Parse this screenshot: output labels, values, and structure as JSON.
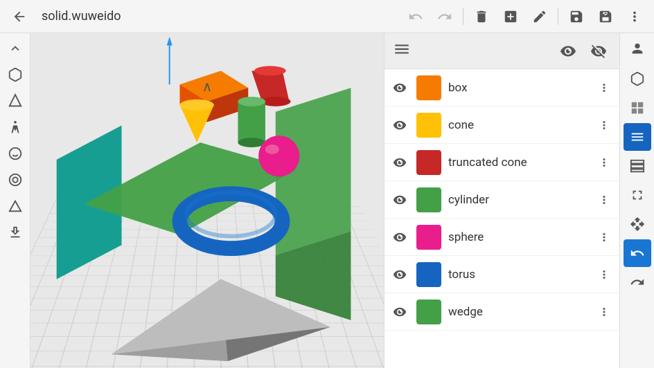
{
  "header": {
    "back_icon": "←",
    "title": "solid.wuweido",
    "undo_icon": "←",
    "redo_icon": "→",
    "delete_icon": "🗑",
    "add_icon": "⊞",
    "edit_icon": "✎",
    "save_icon": "💾",
    "save_as_icon": "💾+",
    "more_icon": "⋮"
  },
  "left_sidebar": {
    "items": [
      {
        "name": "move-up-btn",
        "icon": "∧"
      },
      {
        "name": "box-btn",
        "icon": "□"
      },
      {
        "name": "cone-btn",
        "icon": "△"
      },
      {
        "name": "figure-btn",
        "icon": "🧍"
      },
      {
        "name": "head-btn",
        "icon": "😀"
      },
      {
        "name": "ring-btn",
        "icon": "⊙"
      },
      {
        "name": "triangle-btn",
        "icon": "△"
      },
      {
        "name": "download-btn",
        "icon": "⬇"
      }
    ]
  },
  "panel": {
    "header_icon": "☰",
    "eye_open_icon": "👁",
    "eye_closed_icon": "—",
    "shapes": [
      {
        "name": "box",
        "color": "#f57c00",
        "visible": true
      },
      {
        "name": "cone",
        "color": "#ffc107",
        "visible": true
      },
      {
        "name": "truncated cone",
        "color": "#c62828",
        "visible": true
      },
      {
        "name": "cylinder",
        "color": "#43a047",
        "visible": true
      },
      {
        "name": "sphere",
        "color": "#e91e8c",
        "visible": true
      },
      {
        "name": "torus",
        "color": "#1565c0",
        "visible": true
      },
      {
        "name": "wedge",
        "color": "#43a047",
        "visible": true
      }
    ]
  },
  "right_sidebar": {
    "items": [
      {
        "name": "person-icon",
        "icon": "🤸",
        "active": false
      },
      {
        "name": "cube-icon",
        "icon": "⬡",
        "active": false
      },
      {
        "name": "grid-icon",
        "icon": "⊞",
        "active": false
      },
      {
        "name": "layers-active-icon",
        "icon": "☰",
        "active": true
      },
      {
        "name": "stack-icon",
        "icon": "◫",
        "active": false
      },
      {
        "name": "expand-icon",
        "icon": "⤡",
        "active": false
      },
      {
        "name": "move-icon",
        "icon": "✛",
        "active": false
      },
      {
        "name": "undo-blue-icon",
        "icon": "↺",
        "active": true
      },
      {
        "name": "redo-icon",
        "icon": "↻",
        "active": false
      }
    ]
  }
}
